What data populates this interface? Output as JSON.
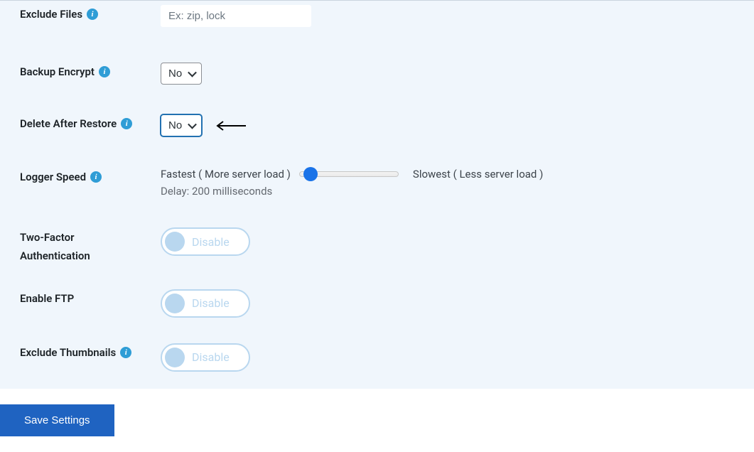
{
  "rows": {
    "exclude_files": {
      "label": "Exclude Files",
      "placeholder": "Ex: zip, lock"
    },
    "backup_encrypt": {
      "label": "Backup Encrypt",
      "value": "No"
    },
    "delete_after_restore": {
      "label": "Delete After Restore",
      "value": "No"
    },
    "logger_speed": {
      "label": "Logger Speed",
      "left_text": "Fastest ( More server load )",
      "right_text": "Slowest ( Less server load )",
      "delay_text": "Delay: 200 milliseconds"
    },
    "two_factor": {
      "label_line1": "Two-Factor",
      "label_line2": "Authentication",
      "toggle": "Disable"
    },
    "enable_ftp": {
      "label": "Enable FTP",
      "toggle": "Disable"
    },
    "exclude_thumbnails": {
      "label": "Exclude Thumbnails",
      "toggle": "Disable"
    }
  },
  "footer": {
    "save_label": "Save Settings"
  }
}
